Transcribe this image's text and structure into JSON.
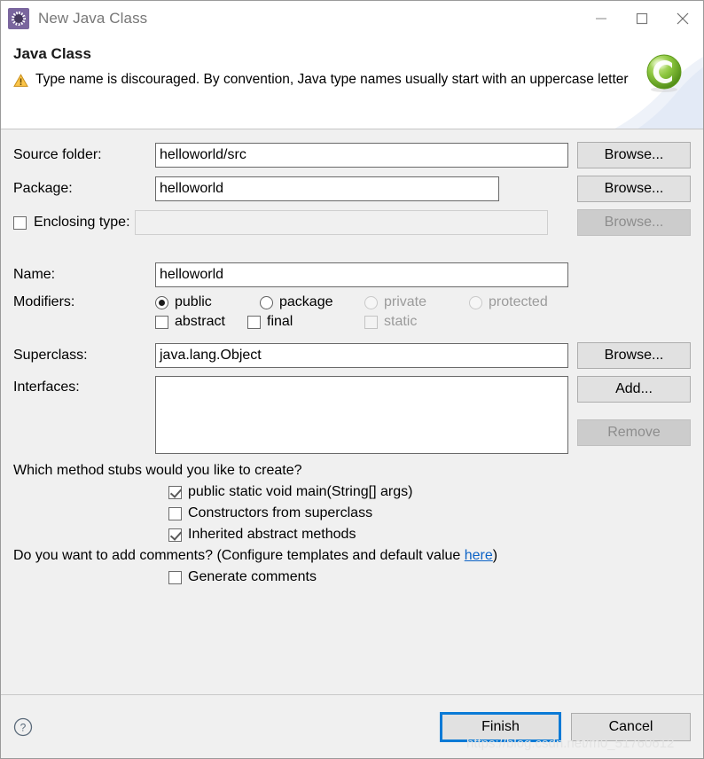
{
  "window": {
    "title": "New Java Class",
    "icon": "java-class-icon",
    "controls": {
      "minimize": "minimize-icon",
      "maximize": "maximize-icon",
      "close": "close-icon"
    }
  },
  "header": {
    "title": "Java Class",
    "warning_icon": "warning-icon",
    "warning_message": "Type name is discouraged. By convention, Java type names usually start with an uppercase letter",
    "logo": "green-c-logo"
  },
  "form": {
    "source_folder": {
      "label": "Source folder:",
      "value": "helloworld/src",
      "placeholder": "",
      "browse_label": "Browse..."
    },
    "package": {
      "label": "Package:",
      "value": "helloworld",
      "placeholder": "",
      "browse_label": "Browse..."
    },
    "enclosing_type": {
      "label": "Enclosing type:",
      "checked": false,
      "value": "",
      "placeholder": "",
      "browse_label": "Browse...",
      "disabled": true
    },
    "name": {
      "label": "Name:",
      "value": "helloworld",
      "placeholder": ""
    },
    "modifiers": {
      "label": "Modifiers:",
      "access": [
        {
          "label": "public",
          "selected": true,
          "disabled": false
        },
        {
          "label": "package",
          "selected": false,
          "disabled": false
        },
        {
          "label": "private",
          "selected": false,
          "disabled": true
        },
        {
          "label": "protected",
          "selected": false,
          "disabled": true
        }
      ],
      "flags": [
        {
          "label": "abstract",
          "checked": false,
          "disabled": false
        },
        {
          "label": "final",
          "checked": false,
          "disabled": false
        },
        {
          "label": "static",
          "checked": false,
          "disabled": true
        }
      ]
    },
    "superclass": {
      "label": "Superclass:",
      "value": "java.lang.Object",
      "placeholder": "",
      "browse_label": "Browse..."
    },
    "interfaces": {
      "label": "Interfaces:",
      "items": [],
      "add_label": "Add...",
      "remove_label": "Remove",
      "remove_disabled": true
    }
  },
  "stubs": {
    "question": "Which method stubs would you like to create?",
    "options": [
      {
        "label": "public static void main(String[] args)",
        "checked": true
      },
      {
        "label": "Constructors from superclass",
        "checked": false
      },
      {
        "label": "Inherited abstract methods",
        "checked": true
      }
    ]
  },
  "comments": {
    "question_prefix": "Do you want to add comments? (Configure templates and default value ",
    "link_text": "here",
    "question_suffix": ")",
    "option": {
      "label": "Generate comments",
      "checked": false
    }
  },
  "footer": {
    "help_icon": "help-icon",
    "finish_label": "Finish",
    "cancel_label": "Cancel"
  },
  "watermark": "https://blog.csdn.net/m0_51760612",
  "colors": {
    "accent": "#0a7ad6",
    "link": "#0d63c6",
    "dialog_bg": "#f0f0f0",
    "warning": "#f0ad29",
    "logo_green": "#7cc126",
    "title_icon": "#7a669e"
  }
}
